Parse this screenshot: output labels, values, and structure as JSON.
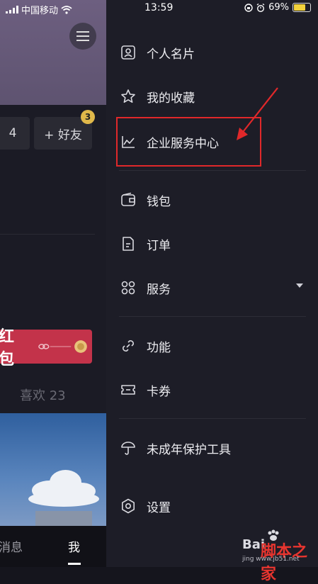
{
  "status_bar": {
    "carrier": "中国移动",
    "time": "13:59",
    "battery": "69%"
  },
  "profile": {
    "stat_partial": "4",
    "add_friend": "+ 好友",
    "friend_badge": "3",
    "red_packet": "红包",
    "likes": "喜欢 23",
    "nav_messages": "消息",
    "nav_me": "我"
  },
  "drawer": {
    "items": [
      {
        "label": "个人名片",
        "icon": "id-card-icon"
      },
      {
        "label": "我的收藏",
        "icon": "star-icon"
      },
      {
        "label": "企业服务中心",
        "icon": "line-chart-icon"
      },
      {
        "label": "钱包",
        "icon": "wallet-icon"
      },
      {
        "label": "订单",
        "icon": "document-icon"
      },
      {
        "label": "服务",
        "icon": "grid-icon"
      },
      {
        "label": "功能",
        "icon": "link-icon"
      },
      {
        "label": "卡券",
        "icon": "ticket-icon"
      },
      {
        "label": "未成年保护工具",
        "icon": "umbrella-icon"
      },
      {
        "label": "设置",
        "icon": "gear-icon"
      }
    ]
  },
  "watermark": {
    "brand": "Bai",
    "site": "脚本之家",
    "url": "jing www.jb51.net"
  },
  "colors": {
    "highlight": "#e0282a",
    "drawer_bg": "#1d1d27",
    "badge": "#e0b84a",
    "red_packet": "#c3334a"
  }
}
